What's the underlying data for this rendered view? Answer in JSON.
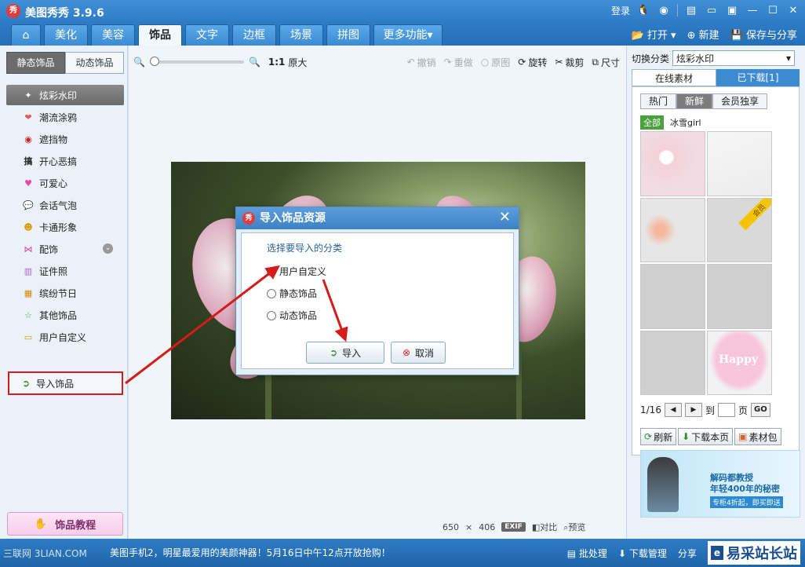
{
  "app": {
    "logo": "秀",
    "title": "美图秀秀 3.9.6",
    "login": "登录"
  },
  "title_icons": [
    "qq-icon",
    "weibo-icon",
    "feedback-icon",
    "message-icon",
    "skin-icon",
    "minimize-icon",
    "maximize-icon",
    "close-icon"
  ],
  "tabs": [
    {
      "label": "美化"
    },
    {
      "label": "美容"
    },
    {
      "label": "饰品"
    },
    {
      "label": "文字"
    },
    {
      "label": "边框"
    },
    {
      "label": "场景"
    },
    {
      "label": "拼图"
    },
    {
      "label": "更多功能"
    }
  ],
  "tab_actions": {
    "open": "打开",
    "new": "新建",
    "save_share": "保存与分享"
  },
  "left": {
    "subtabs": {
      "static": "静态饰品",
      "animated": "动态饰品"
    },
    "categories": [
      {
        "label": "炫彩水印",
        "icon": "sparkle-icon"
      },
      {
        "label": "潮流涂鸦",
        "icon": "lips-icon"
      },
      {
        "label": "遮挡物",
        "icon": "mask-icon"
      },
      {
        "label": "开心恶搞",
        "icon": "funny-icon"
      },
      {
        "label": "可爱心",
        "icon": "heart-icon"
      },
      {
        "label": "会话气泡",
        "icon": "bubble-icon"
      },
      {
        "label": "卡通形象",
        "icon": "cartoon-icon"
      },
      {
        "label": "配饰",
        "icon": "bow-icon"
      },
      {
        "label": "证件照",
        "icon": "shirt-icon"
      },
      {
        "label": "缤纷节日",
        "icon": "gift-icon"
      },
      {
        "label": "其他饰品",
        "icon": "star-icon"
      },
      {
        "label": "用户自定义",
        "icon": "folder-icon"
      }
    ],
    "import_label": "导入饰品",
    "tutorial_label": "饰品教程"
  },
  "toolbar": {
    "zoom_ratio": "1:1",
    "zoom_original": "原大",
    "undo": "撤销",
    "redo": "重做",
    "original": "原图",
    "rotate": "旋转",
    "crop": "裁剪",
    "size": "尺寸"
  },
  "image_info": {
    "width": "650",
    "times": "×",
    "height": "406",
    "exif": "EXIF",
    "compare": "对比",
    "preview": "预览"
  },
  "dialog": {
    "logo": "秀",
    "title": "导入饰品资源",
    "prompt": "选择要导入的分类",
    "options": [
      "用户自定义",
      "静态饰品",
      "动态饰品"
    ],
    "selected_index": 0,
    "import_btn": "导入",
    "cancel_btn": "取消"
  },
  "right": {
    "switch_label": "切换分类",
    "switch_value": "炫彩水印",
    "tab_online": "在线素材",
    "tab_downloaded": "已下载[1]",
    "filters": [
      "热门",
      "新鲜",
      "会员独享"
    ],
    "active_filter": "新鲜",
    "tag_all": "全部",
    "tag_item": "冰雪girl",
    "vip_badge": "会员",
    "happy_text": "Happy",
    "page": "1/16",
    "goto": "到",
    "page_unit": "页",
    "go": "GO",
    "refresh": "刷新",
    "download_page": "下载本页",
    "pack": "素材包",
    "ad_line1": "解码都教授",
    "ad_line2": "年轻400年的秘密",
    "ad_cta": "专柜4折起，即买即送"
  },
  "bottom": {
    "watermark": "三联网 3LIAN.COM",
    "message": "美图手机2，明星最爱用的美颜神器！5月16日中午12点开放抢购！",
    "batch": "批处理",
    "download_mgr": "下载管理",
    "share": "分享",
    "site": "易采站长站"
  },
  "colors": {
    "accent": "#2e7cc6",
    "highlight_red": "#d61b1b",
    "active_gray": "#6c6c6c"
  }
}
